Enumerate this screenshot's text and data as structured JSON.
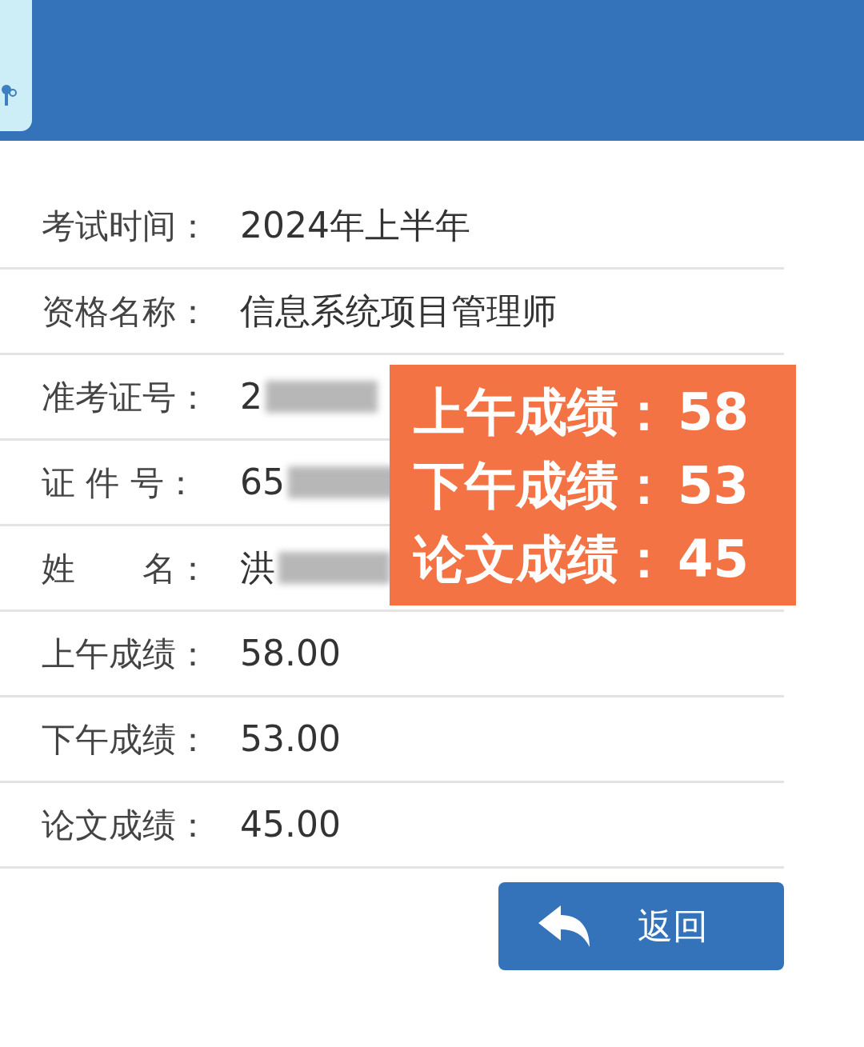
{
  "rows": [
    {
      "label": "考试时间：",
      "value": "2024年上半年",
      "redacted": false
    },
    {
      "label": "资格名称：",
      "value": "信息系统项目管理师",
      "redacted": false
    },
    {
      "label": "准考证号：",
      "value": "2",
      "redacted": true
    },
    {
      "label": "证 件 号：",
      "value": "65",
      "redacted": true
    },
    {
      "label": "姓　　名：",
      "value": "洪",
      "redacted": true
    },
    {
      "label": "上午成绩：",
      "value": "58.00",
      "redacted": false
    },
    {
      "label": "下午成绩：",
      "value": "53.00",
      "redacted": false
    },
    {
      "label": "论文成绩：",
      "value": "45.00",
      "redacted": false
    }
  ],
  "overlay": [
    {
      "label": "上午成绩：",
      "score": "58"
    },
    {
      "label": "下午成绩：",
      "score": "53"
    },
    {
      "label": "论文成绩：",
      "score": "45"
    }
  ],
  "back_button": {
    "label": "返回"
  }
}
